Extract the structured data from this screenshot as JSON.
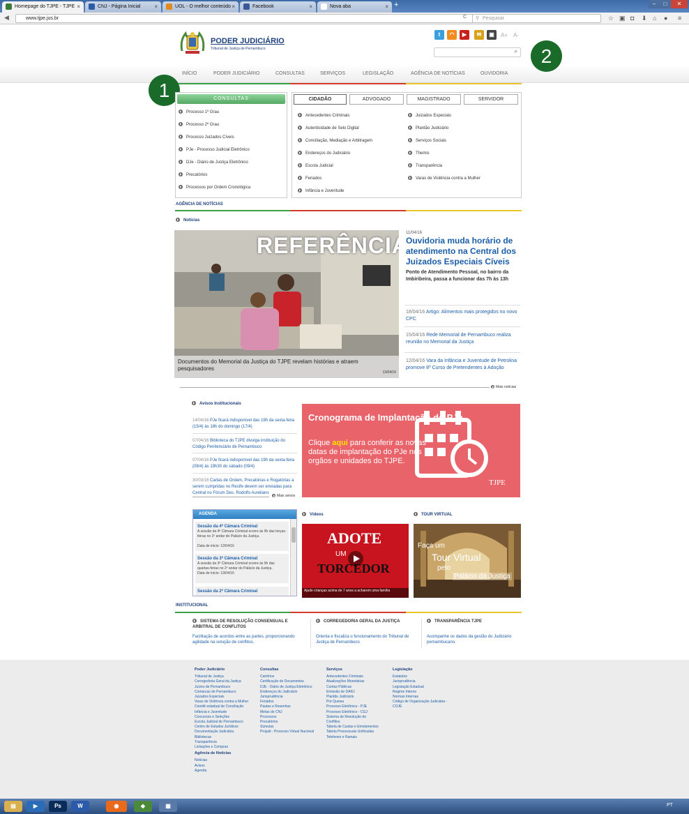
{
  "browser": {
    "tabs": [
      {
        "title": "Homepage do TJPE - TJPE",
        "color": "#3a7a3a"
      },
      {
        "title": "CNJ - Página Inicial",
        "color": "#2a5ca8"
      },
      {
        "title": "UOL - O melhor conteúdo",
        "color": "#e08a20"
      },
      {
        "title": "Facebook",
        "color": "#3b5998"
      },
      {
        "title": "Nova aba",
        "color": "#ffffff"
      }
    ],
    "newtab": "+",
    "url": "www.tjpe.jus.br",
    "search_placeholder": "Pesquisar"
  },
  "header": {
    "brand": "PODER JUDICIÁRIO",
    "sub": "Tribunal de Justiça de Pernambuco",
    "font_minus": "A+",
    "font_plus": "A-"
  },
  "annotations": [
    "1",
    "2"
  ],
  "menu": [
    "INÍCIO",
    "PODER JUDICIÁRIO",
    "CONSULTAS",
    "SERVIÇOS",
    "LEGISLAÇÃO",
    "AGÊNCIA DE NOTÍCIAS",
    "OUVIDORIA"
  ],
  "consultas": {
    "title": "CONSULTAS",
    "items": [
      "Processo 1º Grau",
      "Processo 2º Grau",
      "Processo Juizados Cíveis",
      "PJe - Processo Judicial Eletrônico",
      "DJe - Diário de Justiça Eletrônico",
      "Precatórios",
      "Processos por Ordem Cronológica"
    ]
  },
  "publico": {
    "tabs": [
      "CIDADÃO",
      "ADVOGADO",
      "MAGISTRADO",
      "SERVIDOR"
    ],
    "col1": [
      "Antecedentes Criminais",
      "Autenticidade de Selo Digital",
      "Conciliação, Mediação e Arbitragem",
      "Endereços do Judiciário",
      "Escola Judicial",
      "Feriados",
      "Infância e Juventude"
    ],
    "col2": [
      "Juizados Especiais",
      "Plantão Judiciário",
      "Serviços Sociais",
      "Themis",
      "Transparência",
      "Varas de Violência contra a Mulher"
    ]
  },
  "agencia": {
    "header": "AGÊNCIA DE NOTÍCIAS",
    "noticias": "Notícias",
    "hero": {
      "overlay": "REFERÊNCIA",
      "caption": "Documentos do Memorial da Justiça do TJPE revelam histórias e atraem pesquisadores",
      "date": "13/04/16"
    },
    "main": {
      "date": "11/04/16",
      "title": "Ouvidoria muda horário de atendimento na Central dos Juizados Especiais Cíveis",
      "sub": "Ponto de Atendimento Pessoal, no bairro da Imbiribeira, passa a funcionar das 7h às 13h"
    },
    "side": [
      {
        "date": "18/04/16",
        "text": "Artigo: Alimentos mais protegidos no novo CPC"
      },
      {
        "date": "15/04/16",
        "text": "Rede Memorial de Pernambuco realiza reunião no Memorial da Justiça"
      },
      {
        "date": "12/04/16",
        "text": "Vara da Infância e Juventude de Petrolina promove 8º Curso de Pretendentes à Adoção"
      }
    ],
    "mais": "Mais notícias"
  },
  "avisos": {
    "title": "Avisos Institucionais",
    "items": [
      {
        "date": "14/04/16",
        "text": "PJe ficará indisponível das 19h da sexta-feira (15/4) às 18h do domingo (17/4)"
      },
      {
        "date": "07/04/16",
        "text": "Biblioteca do TJPE divulga instituição do Código Penitenciário de Pernambuco"
      },
      {
        "date": "07/04/16",
        "text": "PJe ficará indisponível das 19h da sexta-feira (08/4) às 19h30 do sábado (09/4)"
      },
      {
        "date": "30/03/16",
        "text": "Cartas de Ordem, Precatórias e Rogatórias a serem cumpridas no Recife devem ser enviadas para Central no Fórum Des. Rodolfo Aureliano"
      }
    ],
    "mais": "Mais avisos"
  },
  "banner": {
    "title": "Cronograma de Implantação do PJe",
    "pre": "Clique ",
    "link": "aqui",
    "post": " para conferir as novas datas de implantação do PJe nos orgãos e unidades do TJPE.",
    "logo": "TJPE"
  },
  "agenda": {
    "title": "AGENDA",
    "items": [
      {
        "title": "Sessão da 4ª Câmara Criminal",
        "text": "A sessão da 4ª Câmara Criminal ocorre às 9h das terças-feiras no 2º andar do Palácio da Justiça.",
        "date": "Data de início: 12/04/16"
      },
      {
        "title": "Sessão da 3ª Câmara Criminal",
        "text": "A sessão da 3ª Câmara Criminal ocorre às 9h das quartas-feiras no 2º andar do Palácio da Justiça.",
        "date": "Data de início: 13/04/16"
      },
      {
        "title": "Sessão da 2ª Câmara Criminal",
        "text": "",
        "date": ""
      }
    ]
  },
  "videos": {
    "title": "Vídeos",
    "caption": "Ajude crianças acima de 7 anos a acharem uma família",
    "art1": "ADOTE",
    "art2": "UM",
    "art3": "TORCEDOR"
  },
  "tour": {
    "title": "TOUR VIRTUAL",
    "l1": "Faça um",
    "l2": "Tour Virtual",
    "l3": "pelo",
    "l4": "Palácio da Justiça"
  },
  "institucional": {
    "header": "INSTITUCIONAL",
    "items": [
      {
        "title": "SISTEMA DE RESOLUÇÃO CONSENSUAL E ARBITRAL DE CONFLITOS",
        "text": "Facilitação de acordos entre as partes, proporcionando agilidade na solução de conflitos."
      },
      {
        "title": "CORREGEDORIA GERAL DA JUSTIÇA",
        "text": "Orienta e fiscaliza o funcionamento do Tribunal de Justiça de Pernambuco"
      },
      {
        "title": "TRANSPARÊNCIA TJPE",
        "text": "Acompanhe os dados da gestão do Judiciário pernambucano."
      }
    ]
  },
  "footer": {
    "cols": [
      {
        "title": "Poder Judiciário",
        "items": [
          "Tribunal de Justiça",
          "Corregedoria Geral da Justiça",
          "Juízes de Pernambuco",
          "Comarcas de Pernambuco",
          "Juizados Especiais",
          "Varas de Violência contra a Mulher",
          "Comitê estadual de Conciliação",
          "Infância e Juventude",
          "Concursos e Seleções",
          "Escola Judicial de Pernambuco",
          "Centro de Estudos Jurídicos",
          "Documentação Judiciária",
          "Bibliotecas",
          "Transparência",
          "Licitações e Compras"
        ]
      },
      {
        "title": "Consultas",
        "items": [
          "Cartórios",
          "Certificação de Documentos",
          "DJE - Diário de Justiça Eletrônico",
          "Endereços do Judiciário",
          "Jurisprudência",
          "Feriados",
          "Pautas e Resenhas",
          "Metas do CNJ",
          "Processos",
          "Precatórios",
          "Súmulas",
          "Projudi - Processo Virtual Nacional"
        ]
      },
      {
        "title": "Serviços",
        "items": [
          "Antecedentes Criminais",
          "Atualizações Monetárias",
          "Contas Públicas",
          "Emissão de DARJ",
          "Plantão Judiciário",
          "Pré Queixa",
          "Processo Eletrônico - PJE",
          "Processo Eletrônico - CGJ",
          "Sistema de Resolução de",
          "Conflitos",
          "Tabela de Custas e Emolumentos",
          "Tabela Processuais Unificadas",
          "Telefones e Ramais"
        ]
      },
      {
        "title": "Legislação",
        "items": [
          "Estatutos",
          "Jurisprudência",
          "Legislação Estadual",
          "Regime Interno",
          "Normas Internas",
          "Código de Organização Judiciária -",
          "COJE"
        ]
      }
    ],
    "agencia_title": "Agência de Notícias",
    "agencia_items": [
      "Notícias",
      "Avisos",
      "Agenda"
    ]
  },
  "taskbar": {
    "locale": "PT"
  }
}
